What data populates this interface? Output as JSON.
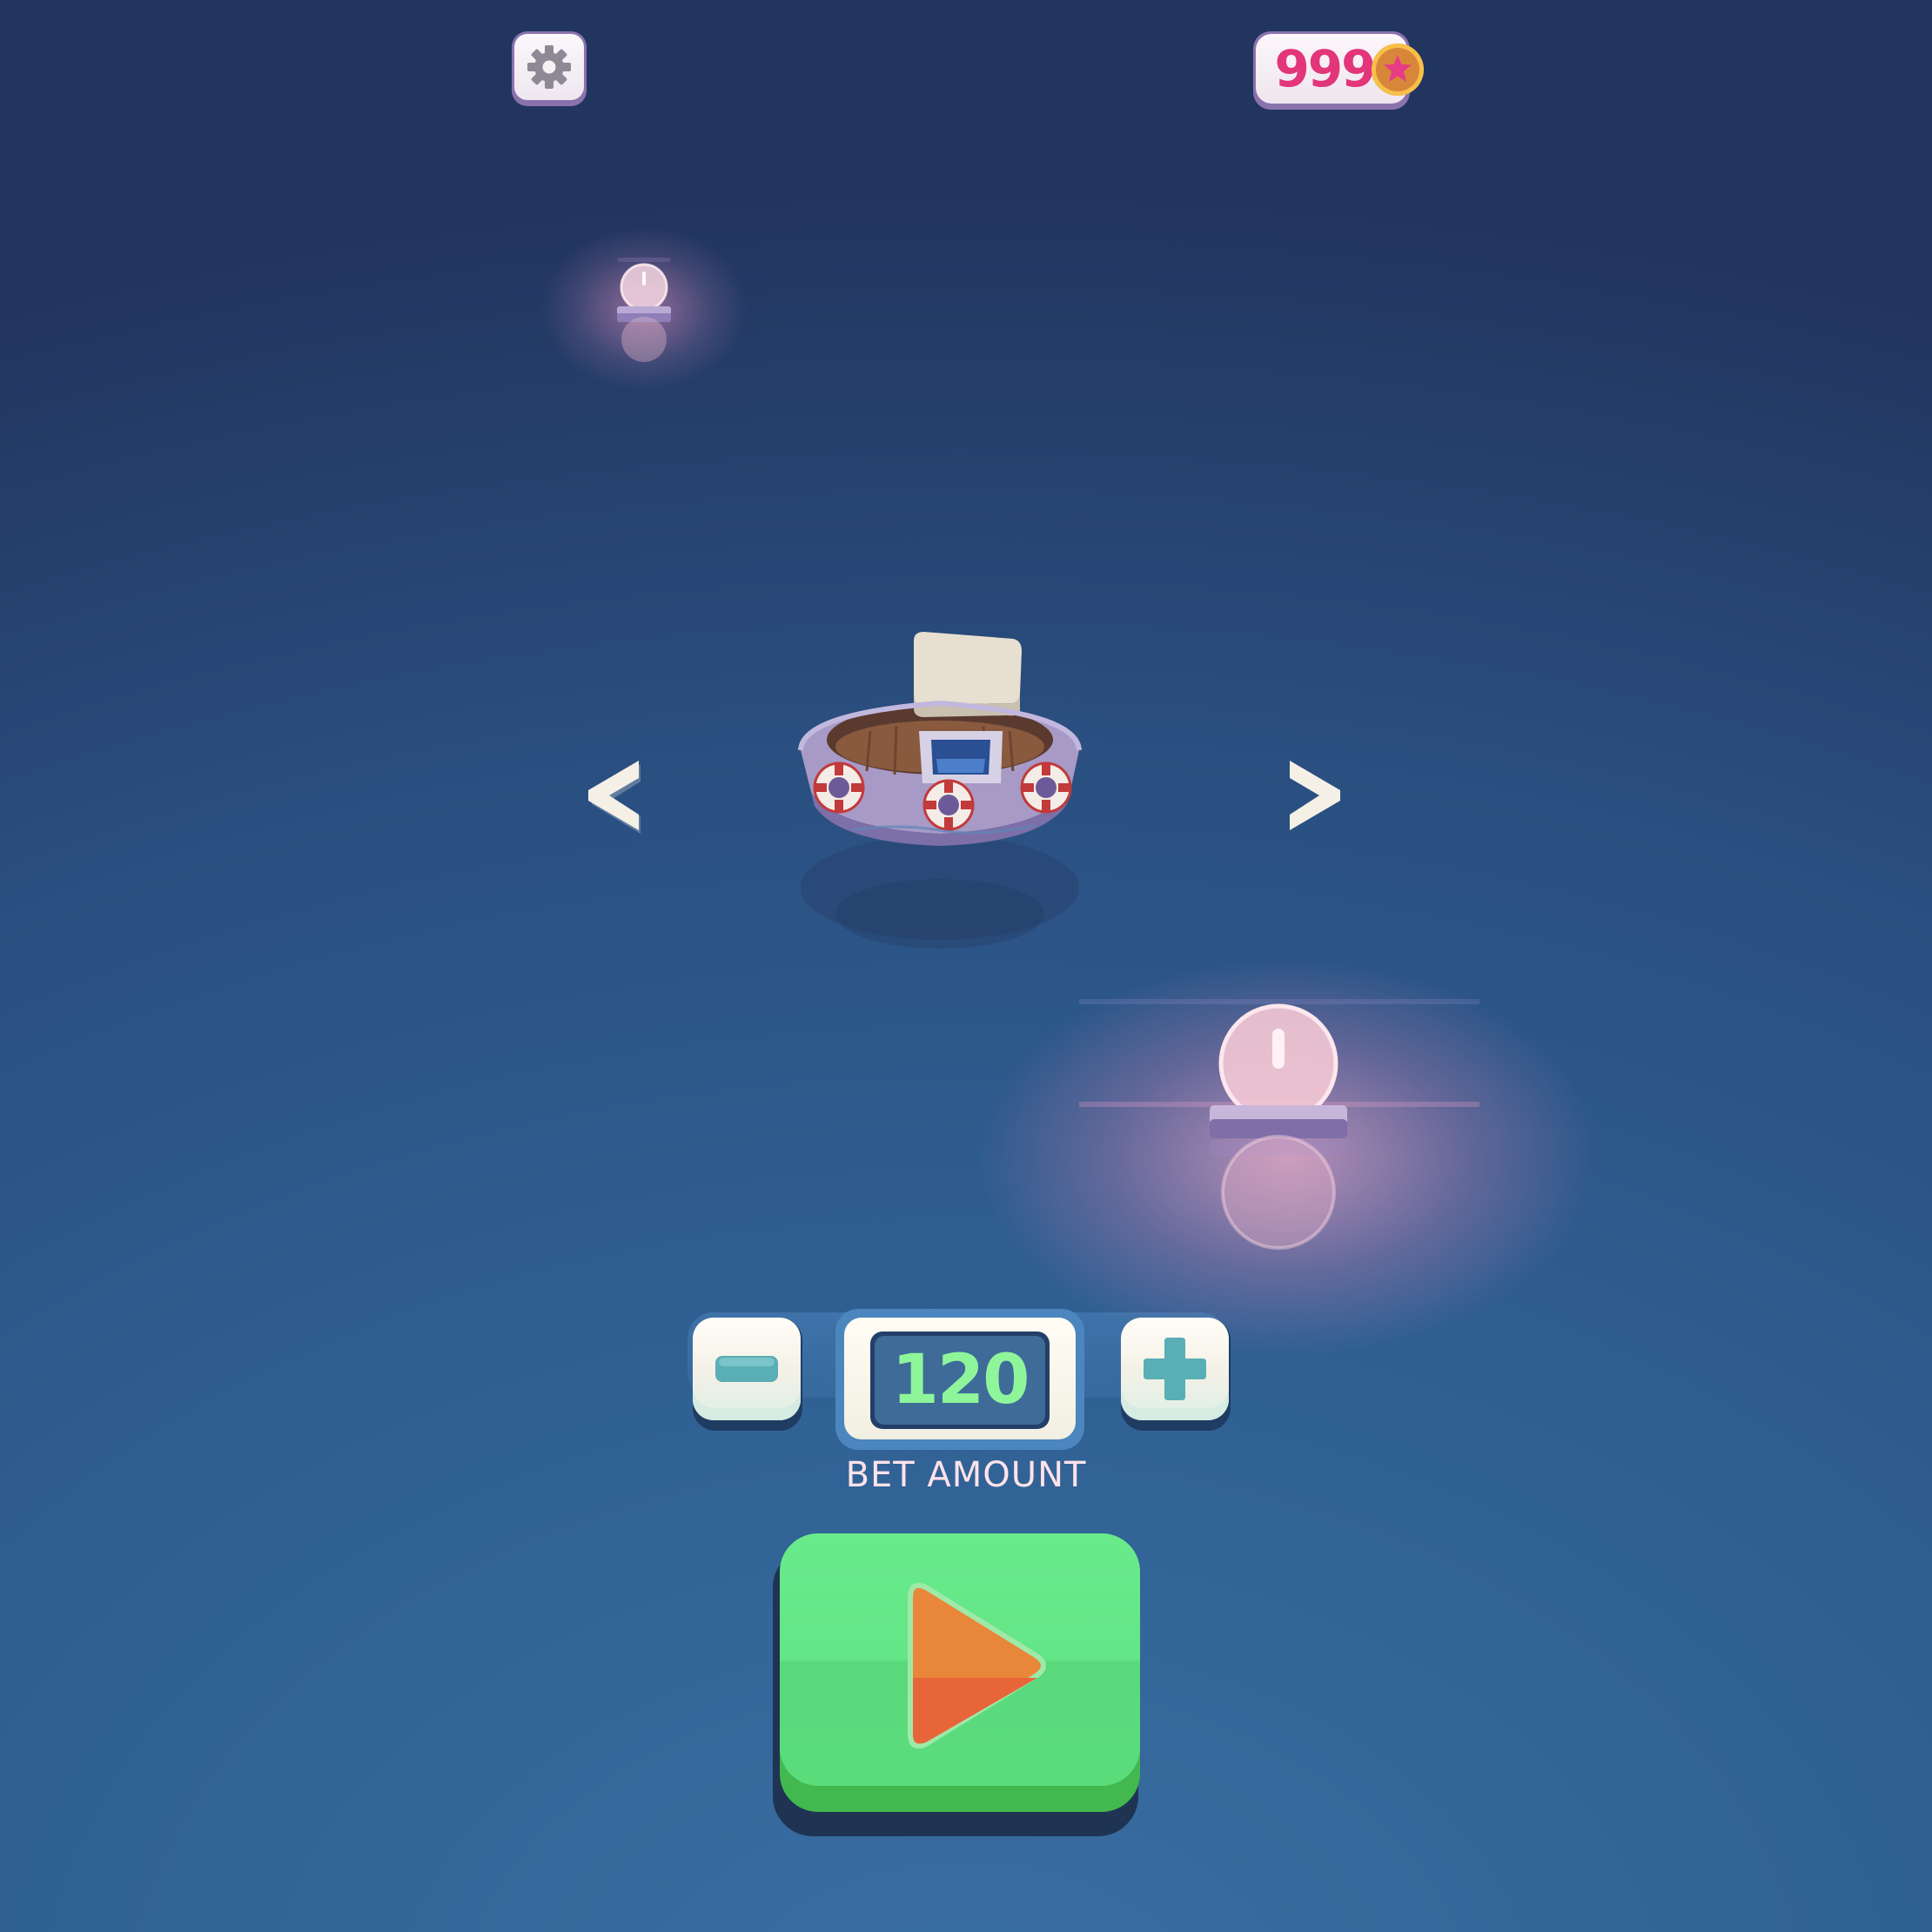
{
  "hud": {
    "settings_icon": "gear-icon",
    "coins": "999",
    "coin_icon": "star-coin-icon"
  },
  "navigation": {
    "prev_label": "<",
    "next_label": ">"
  },
  "bet": {
    "amount": "120",
    "label": "BET AMOUNT",
    "decrease_icon": "minus-icon",
    "increase_icon": "plus-icon"
  },
  "play": {
    "icon": "play-icon"
  },
  "colors": {
    "coin_text": "#e2357a",
    "bet_text": "#8ff59b",
    "play_green": "#64e587",
    "play_triangle": "#e8873a"
  }
}
